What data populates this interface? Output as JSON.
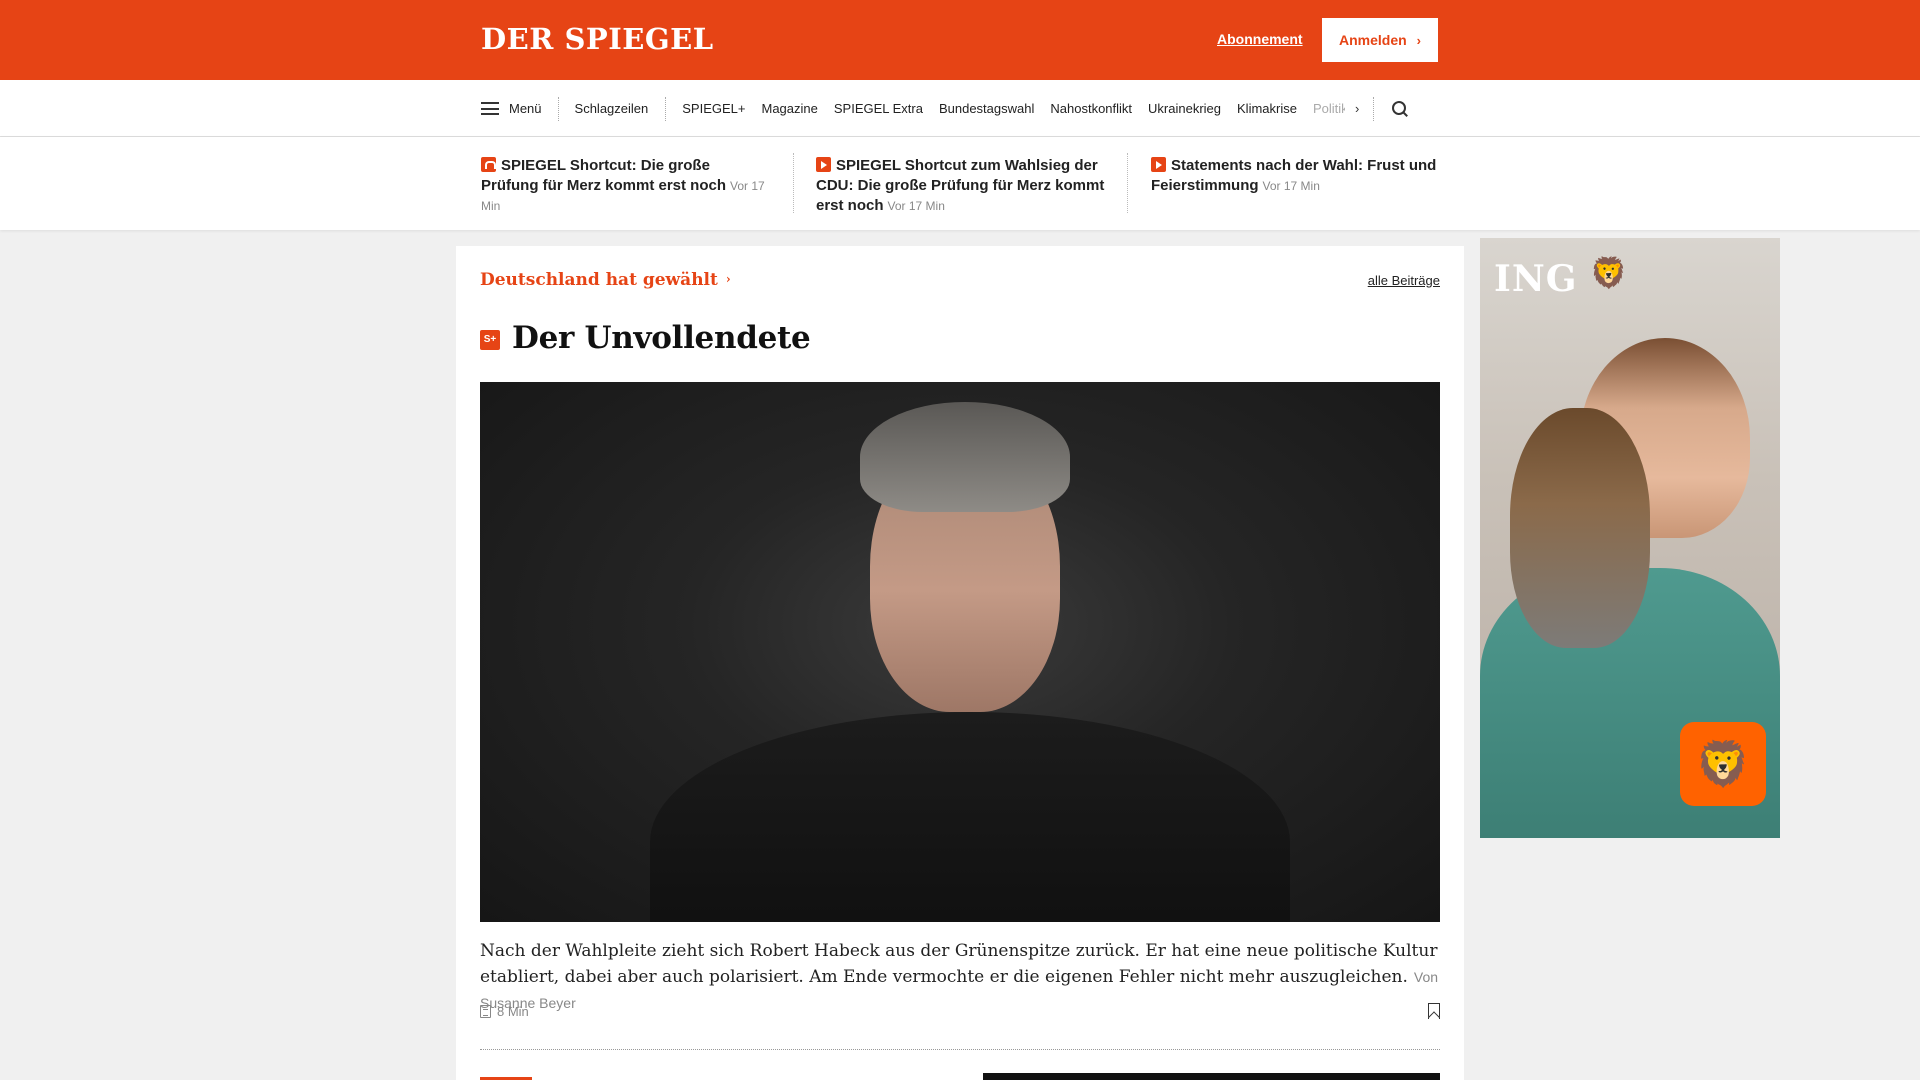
{
  "header": {
    "logo": "DER SPIEGEL",
    "subscription_link": "Abonnement",
    "login_button": "Anmelden",
    "brand_color": "#e64415"
  },
  "nav": {
    "menu_label": "Menü",
    "items": [
      "Schlagzeilen",
      "SPIEGEL+",
      "Magazine",
      "SPIEGEL Extra",
      "Bundestagswahl",
      "Nahostkonflikt",
      "Ukrainekrieg",
      "Klimakrise"
    ],
    "faded_item": "Politik",
    "more_icon": "chevron-right-icon",
    "search_icon": "search-icon"
  },
  "teasers": [
    {
      "icon": "audio-icon",
      "title": "SPIEGEL Shortcut: Die große Prüfung für Merz kommt erst noch",
      "time": "Vor 17 Min"
    },
    {
      "icon": "video-play-icon",
      "title": "SPIEGEL Shortcut zum Wahlsieg der CDU: Die große Prüfung für Merz kommt erst noch",
      "time": "Vor 17 Min"
    },
    {
      "icon": "video-play-icon",
      "title": "Statements nach der Wahl: Frust und Feierstimmung",
      "time": "Vor 17 Min"
    }
  ],
  "article": {
    "rubric": "Deutschland hat gewählt",
    "all_link": "alle Beiträge",
    "plus_badge": "S+",
    "headline": "Der Unvollendete",
    "teaser_text": "Nach der Wahlpleite zieht sich Robert Habeck aus der Grünenspitze zurück. Er hat eine neue politische Kultur etabliert, dabei aber auch polarisiert. Am Ende vermochte er die eigenen Fehler nicht mehr auszugleichen.",
    "author": "Von Susanne Beyer",
    "read_time": "8 Min"
  },
  "ad": {
    "brand": "ING",
    "brand_color": "#ff6200"
  }
}
